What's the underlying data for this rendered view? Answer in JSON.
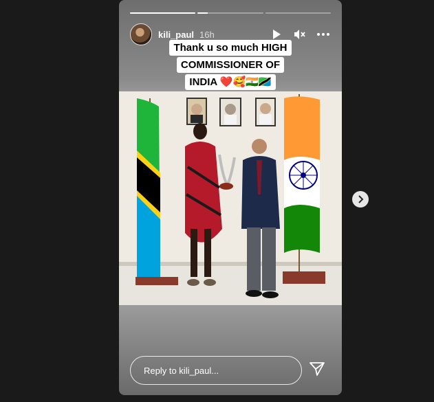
{
  "story": {
    "username": "kili_paul",
    "time": "16h",
    "progress": [
      1.0,
      0.15,
      0.0
    ],
    "caption": {
      "line1": "Thank u so much HIGH",
      "line2": "COMMISSIONER OF",
      "line3": "INDIA ❤️🥰🇮🇳🇹🇿"
    },
    "reply_placeholder": "Reply to kili_paul..."
  },
  "icons": {
    "play": "play-icon",
    "mute": "mute-icon",
    "more": "more-icon",
    "send": "send-icon",
    "next": "chevron-right-icon"
  },
  "colors": {
    "background": "#1a1a1a",
    "white": "#ffffff"
  }
}
